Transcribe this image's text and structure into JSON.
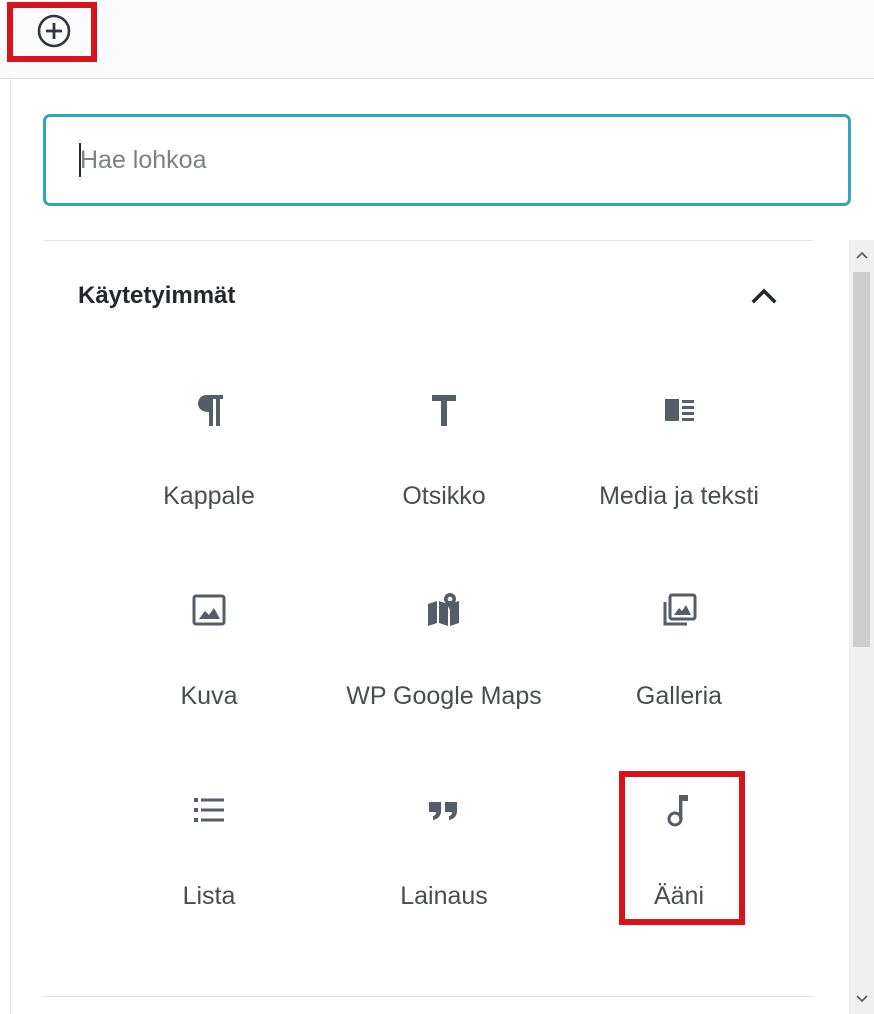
{
  "toolbar": {
    "add_block_icon": "plus-circle-icon"
  },
  "search": {
    "placeholder": "Hae lohkoa",
    "value": ""
  },
  "section": {
    "title": "Käytetyimmät",
    "toggle_icon": "chevron-up-icon",
    "expanded": true
  },
  "blocks": [
    {
      "label": "Kappale",
      "icon": "paragraph-icon"
    },
    {
      "label": "Otsikko",
      "icon": "heading-icon"
    },
    {
      "label": "Media ja teksti",
      "icon": "media-text-icon"
    },
    {
      "label": "Kuva",
      "icon": "image-icon"
    },
    {
      "label": "WP Google Maps",
      "icon": "map-icon"
    },
    {
      "label": "Galleria",
      "icon": "gallery-icon"
    },
    {
      "label": "Lista",
      "icon": "list-icon"
    },
    {
      "label": "Lainaus",
      "icon": "quote-icon"
    },
    {
      "label": "Ääni",
      "icon": "audio-icon"
    }
  ],
  "colors": {
    "focus_border": "#33a3c2",
    "highlight": "#d7141c",
    "icon": "#555d66",
    "label": "#4a4d50"
  }
}
